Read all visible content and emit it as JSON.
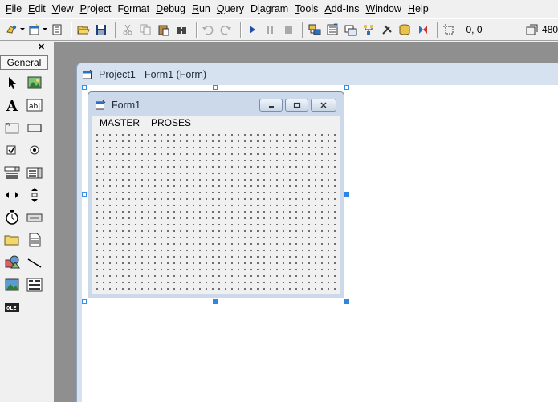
{
  "menu": [
    "File",
    "Edit",
    "View",
    "Project",
    "Format",
    "Debug",
    "Run",
    "Query",
    "Diagram",
    "Tools",
    "Add-Ins",
    "Window",
    "Help"
  ],
  "menu_underline": [
    "F",
    "E",
    "V",
    "P",
    "o",
    "D",
    "R",
    "Q",
    "i",
    "T",
    "A",
    "W",
    "H"
  ],
  "toolbar": {
    "position": "0, 0",
    "size": "480"
  },
  "toolbox": {
    "tab_label": "General",
    "close_label": "✕"
  },
  "designer": {
    "title": "Project1 - Form1 (Form)"
  },
  "form": {
    "title": "Form1",
    "menu": [
      "MASTER",
      "PROSES"
    ]
  },
  "icons": [
    "pointer-icon",
    "picturebox-icon",
    "label-icon",
    "textbox-icon",
    "frame-icon",
    "commandbutton-icon",
    "checkbox-icon",
    "optionbutton-icon",
    "combobox-icon",
    "listbox-icon",
    "hscrollbar-icon",
    "vscrollbar-icon",
    "timer-icon",
    "drivelistbox-icon",
    "dirlistbox-icon",
    "filelistbox-icon",
    "shape-icon",
    "line-icon",
    "image-icon",
    "data-icon",
    "ole-icon"
  ]
}
